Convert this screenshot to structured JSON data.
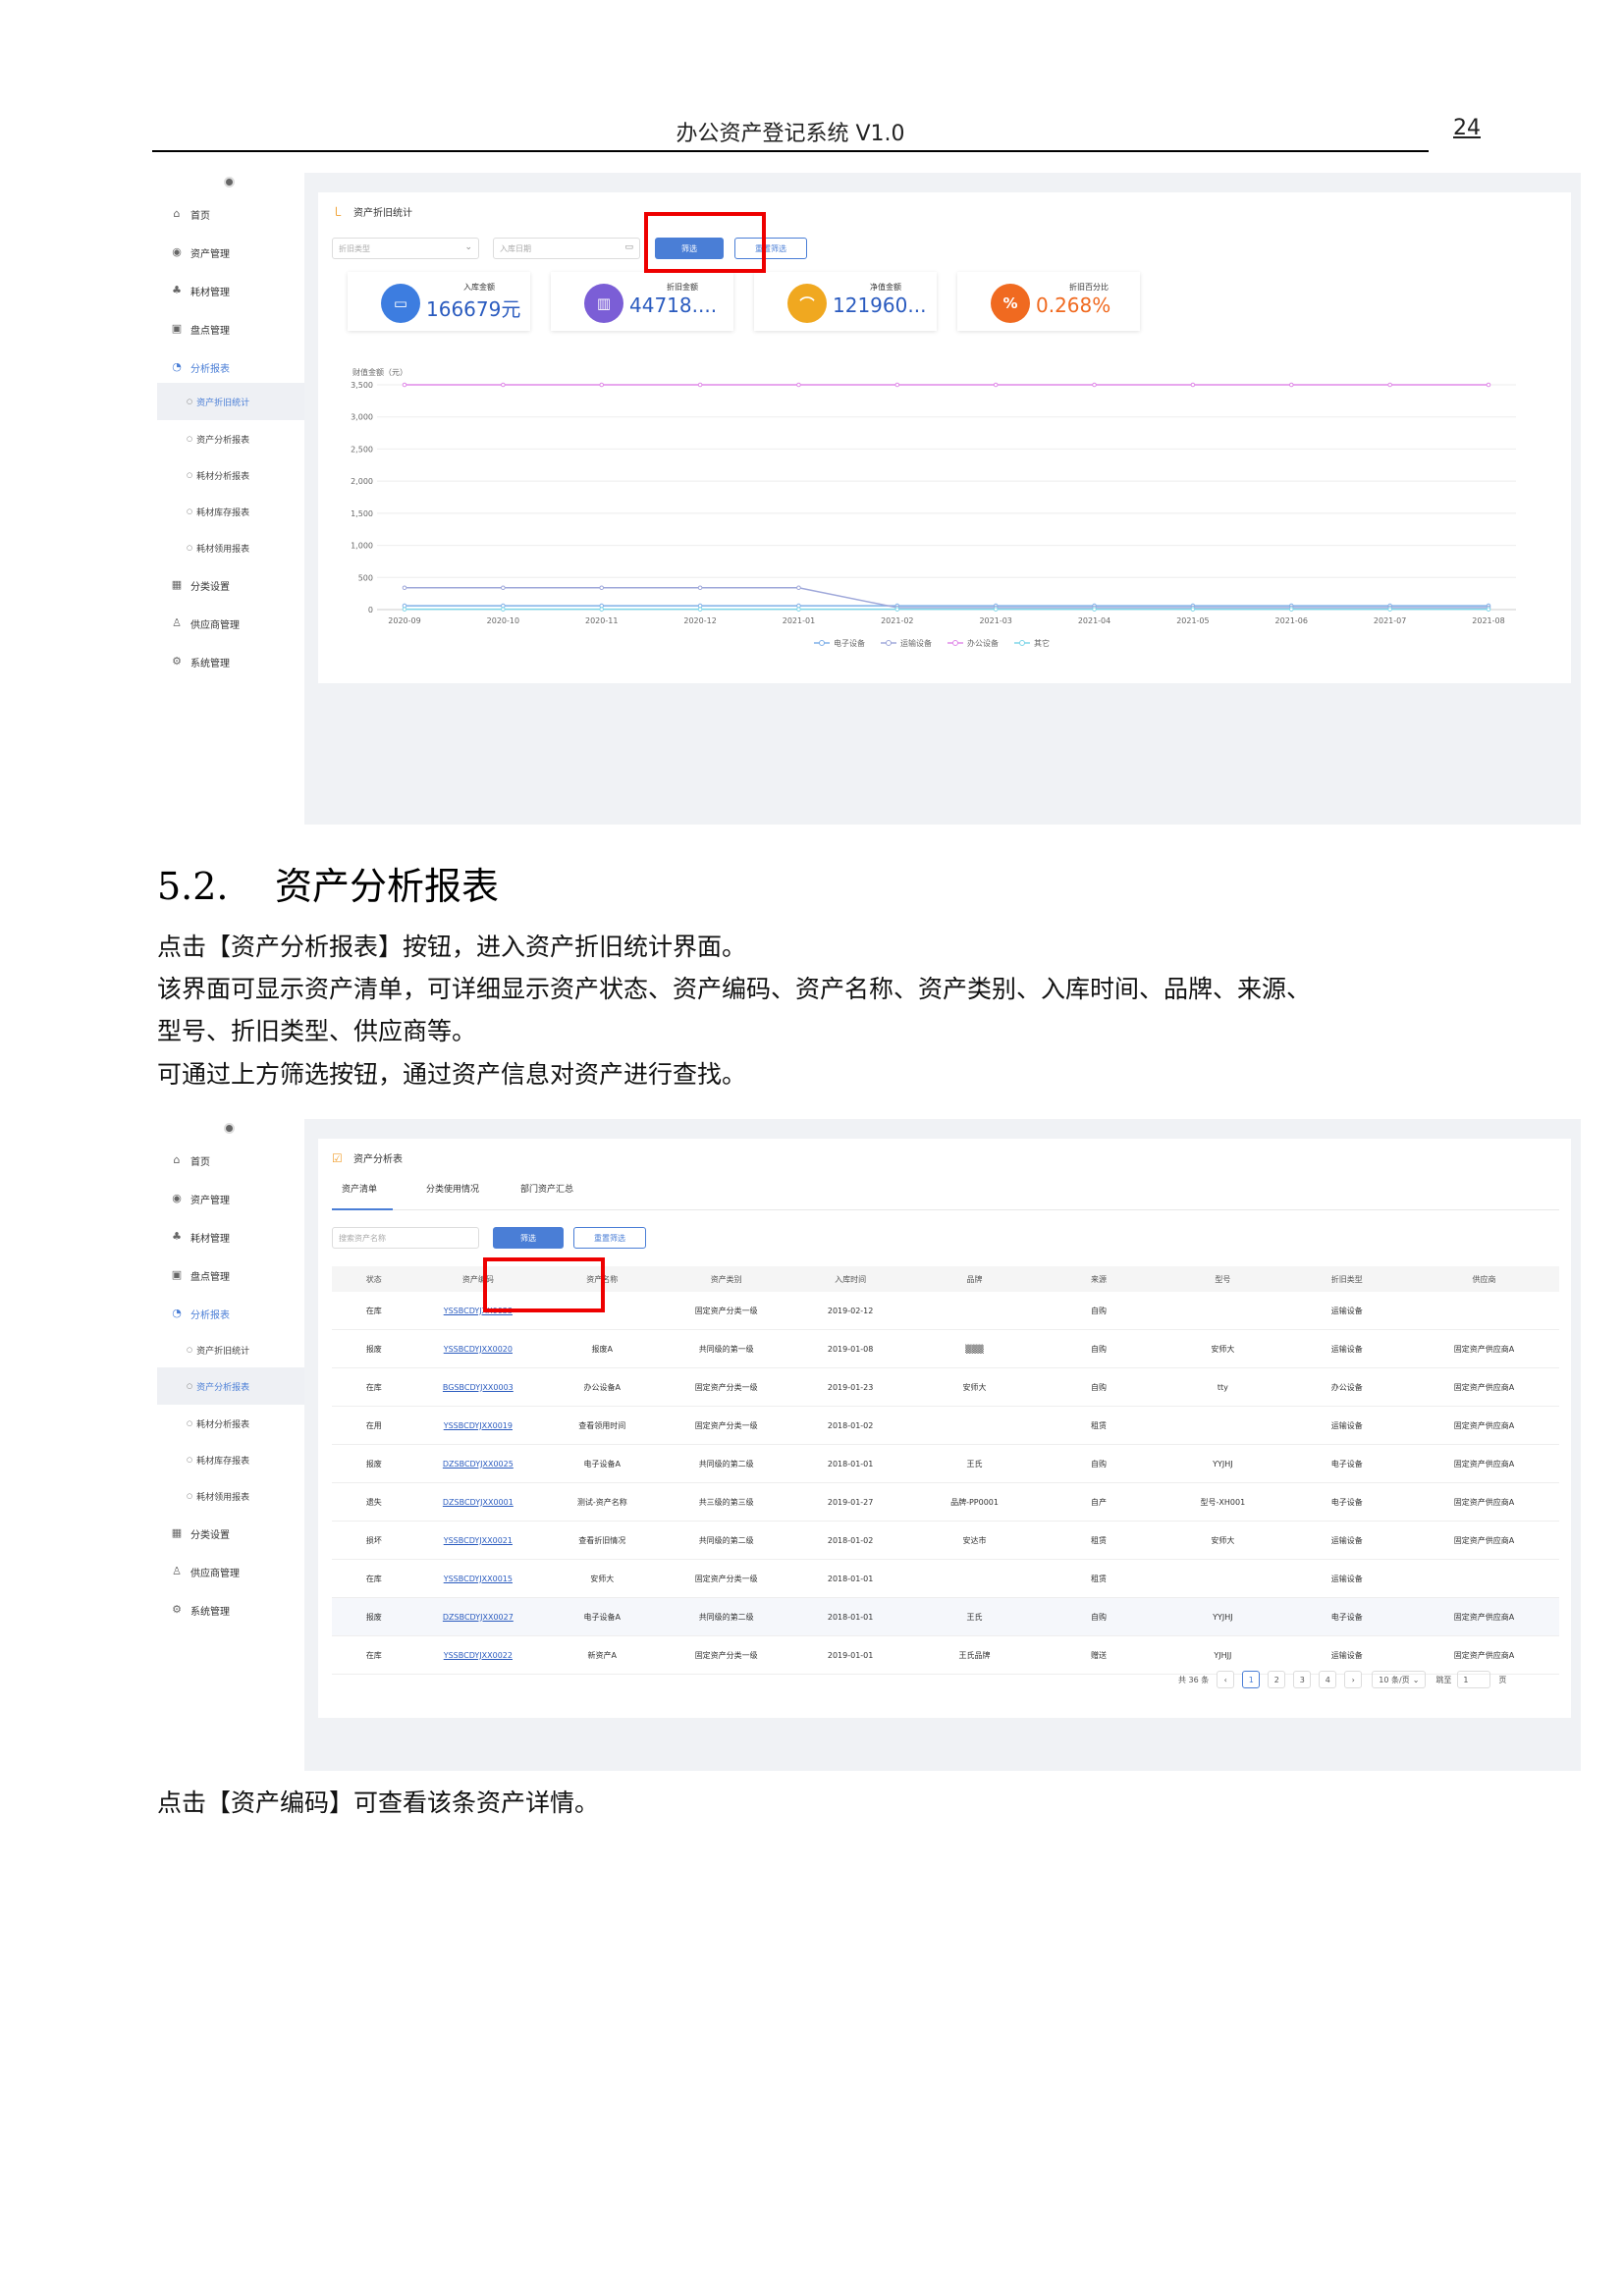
{
  "header": {
    "title": "办公资产登记系统 V1.0",
    "page_number": "24"
  },
  "sidebar1": {
    "items": [
      {
        "label": "首页",
        "icon": "home-icon"
      },
      {
        "label": "资产管理",
        "icon": "asset-icon"
      },
      {
        "label": "耗材管理",
        "icon": "consumable-icon"
      },
      {
        "label": "盘点管理",
        "icon": "inventory-icon"
      },
      {
        "label": "分析报表",
        "icon": "report-icon"
      }
    ],
    "subitems": [
      "资产折旧统计",
      "资产分析报表",
      "耗材分析报表",
      "耗材库存报表",
      "耗材领用报表"
    ],
    "bottom_items": [
      {
        "label": "分类设置",
        "icon": "category-icon"
      },
      {
        "label": "供应商管理",
        "icon": "supplier-icon"
      },
      {
        "label": "系统管理",
        "icon": "settings-icon"
      }
    ]
  },
  "shot1": {
    "panel_title": "资产折旧统计",
    "filter_type_placeholder": "折旧类型",
    "date_placeholder": "入库日期",
    "filter_button": "筛选",
    "reset_button": "重置筛选",
    "cards": [
      {
        "label": "入库金额",
        "value": "166679元",
        "color": "#3d7de0"
      },
      {
        "label": "折旧金额",
        "value": "44718....",
        "color": "#7b5ed6"
      },
      {
        "label": "净值金额",
        "value": "121960...",
        "color": "#f0a820"
      },
      {
        "label": "折旧百分比",
        "value": "0.268%",
        "color": "#f06a20"
      }
    ]
  },
  "chart_data": {
    "type": "line",
    "ylabel": "财值金额（元）",
    "ylim": [
      0,
      3500
    ],
    "yticks": [
      "3,500",
      "3,000",
      "2,500",
      "2,000",
      "1,500",
      "1,000",
      "500",
      "0"
    ],
    "categories": [
      "2020-09",
      "2020-10",
      "2020-11",
      "2020-12",
      "2021-01",
      "2021-02",
      "2021-03",
      "2021-04",
      "2021-05",
      "2021-06",
      "2021-07",
      "2021-08"
    ],
    "series": [
      {
        "name": "电子设备",
        "color": "#7fb0e8",
        "values": [
          60,
          60,
          60,
          60,
          60,
          60,
          60,
          60,
          60,
          60,
          60,
          60
        ]
      },
      {
        "name": "运输设备",
        "color": "#9fa8da",
        "values": [
          340,
          340,
          340,
          340,
          340,
          30,
          30,
          30,
          30,
          30,
          30,
          30
        ]
      },
      {
        "name": "办公设备",
        "color": "#e08ae8",
        "values": [
          3500,
          3500,
          3500,
          3500,
          3500,
          3500,
          3500,
          3500,
          3500,
          3500,
          3500,
          3500
        ]
      },
      {
        "name": "其它",
        "color": "#7fd6e8",
        "values": [
          5,
          5,
          5,
          5,
          5,
          5,
          5,
          5,
          5,
          5,
          5,
          5
        ]
      }
    ],
    "legend": "bottom"
  },
  "section": {
    "number": "5.2.",
    "title": "资产分析报表",
    "p1": "点击【资产分析报表】按钮，进入资产折旧统计界面。",
    "p2": "该界面可显示资产清单，可详细显示资产状态、资产编码、资产名称、资产类别、入库时间、品牌、来源、",
    "p3": "型号、折旧类型、供应商等。",
    "p4": "可通过上方筛选按钮，通过资产信息对资产进行查找。",
    "p5": "点击【资产编码】可查看该条资产详情。"
  },
  "shot2": {
    "panel_title": "资产分析表",
    "tabs": [
      "资产清单",
      "分类使用情况",
      "部门资产汇总"
    ],
    "search_placeholder": "搜索资产名称",
    "filter_button": "筛选",
    "reset_button": "重置筛选",
    "columns": [
      "状态",
      "资产编码",
      "资产名称",
      "资产类别",
      "入库时间",
      "品牌",
      "来源",
      "型号",
      "折旧类型",
      "供应商"
    ],
    "rows": [
      [
        "在库",
        "YSSBCDYJXX0033",
        "",
        "固定资产分类一级",
        "2019-02-12",
        "",
        "自购",
        "",
        "运输设备",
        ""
      ],
      [
        "报废",
        "YSSBCDYJXX0020",
        "报废A",
        "共同级的第一级",
        "2019-01-08",
        "▒▒▒",
        "自购",
        "安师大",
        "运输设备",
        "固定资产供应商A"
      ],
      [
        "在库",
        "BGSBCDYJXX0003",
        "办公设备A",
        "固定资产分类一级",
        "2019-01-23",
        "安师大",
        "自购",
        "tty",
        "办公设备",
        "固定资产供应商A"
      ],
      [
        "在用",
        "YSSBCDYJXX0019",
        "查看领用时间",
        "固定资产分类一级",
        "2018-01-02",
        "",
        "租赁",
        "",
        "运输设备",
        "固定资产供应商A"
      ],
      [
        "报废",
        "DZSBCDYJXX0025",
        "电子设备A",
        "共同级的第二级",
        "2018-01-01",
        "王氏",
        "自购",
        "YYJHJ",
        "电子设备",
        "固定资产供应商A"
      ],
      [
        "遗失",
        "DZSBCDYJXX0001",
        "测试-资产名称",
        "共三级的第三级",
        "2019-01-27",
        "品牌-PP0001",
        "自产",
        "型号-XH001",
        "电子设备",
        "固定资产供应商A"
      ],
      [
        "损坏",
        "YSSBCDYJXX0021",
        "查看折旧情况",
        "共同级的第二级",
        "2018-01-02",
        "安达市",
        "租赁",
        "安师大",
        "运输设备",
        "固定资产供应商A"
      ],
      [
        "在库",
        "YSSBCDYJXX0015",
        "安师大",
        "固定资产分类一级",
        "2018-01-01",
        "",
        "租赁",
        "",
        "运输设备",
        ""
      ],
      [
        "报废",
        "DZSBCDYJXX0027",
        "电子设备A",
        "共同级的第二级",
        "2018-01-01",
        "王氏",
        "自购",
        "YYJHJ",
        "电子设备",
        "固定资产供应商A"
      ],
      [
        "在库",
        "YSSBCDYJXX0022",
        "新资产A",
        "固定资产分类一级",
        "2019-01-01",
        "王氏品牌",
        "赠送",
        "YJHJJ",
        "运输设备",
        "固定资产供应商A"
      ]
    ],
    "pager": {
      "total": "共 36 条",
      "prev": "‹",
      "pages": [
        "1",
        "2",
        "3",
        "4"
      ],
      "next": "›",
      "size": "10 条/页",
      "jump_label": "跳至",
      "jump_value": "1",
      "page_suffix": "页"
    }
  }
}
